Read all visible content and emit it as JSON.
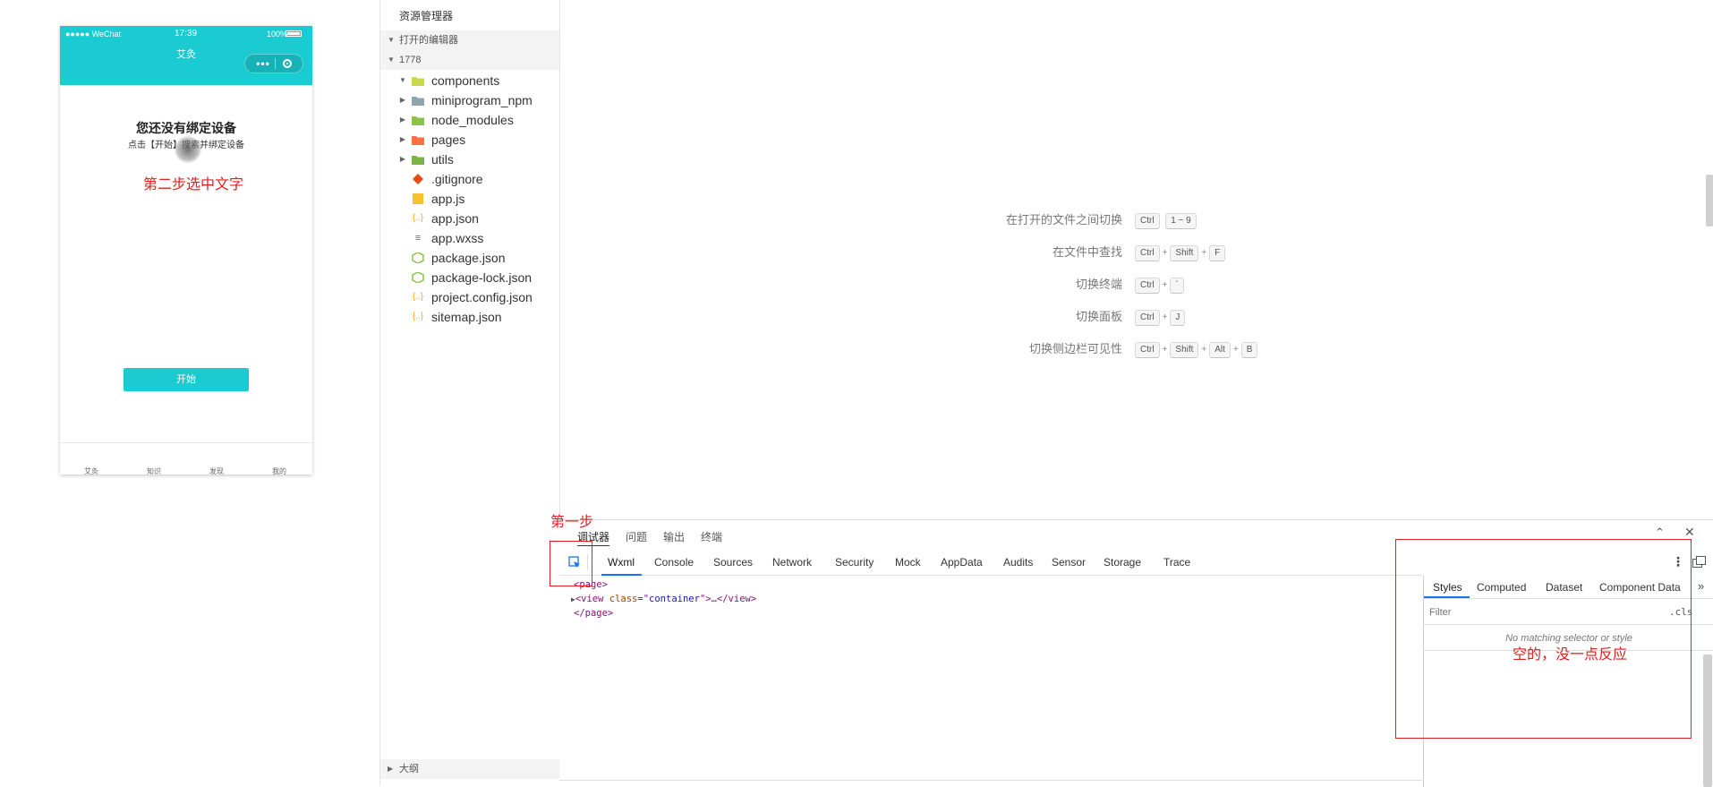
{
  "simulator": {
    "status_left": "●●●●● WeChat",
    "status_time": "17:39",
    "status_battery": "100%",
    "nav_title": "艾灸",
    "capsule_dots": "•••",
    "heading": "您还没有绑定设备",
    "subtext": "点击【开始】搜索并绑定设备",
    "start_button": "开始",
    "tabbar": [
      "艾灸",
      "知识",
      "发现",
      "我的"
    ]
  },
  "explorer": {
    "title": "资源管理器",
    "open_editors": "打开的编辑器",
    "project": "1778",
    "items": [
      {
        "label": "components",
        "type": "folder",
        "icon": "folder-components-icon"
      },
      {
        "label": "miniprogram_npm",
        "type": "folder",
        "icon": "folder-icon"
      },
      {
        "label": "node_modules",
        "type": "folder",
        "icon": "folder-node-icon"
      },
      {
        "label": "pages",
        "type": "folder",
        "icon": "folder-pages-icon"
      },
      {
        "label": "utils",
        "type": "folder",
        "icon": "folder-utils-icon"
      },
      {
        "label": ".gitignore",
        "type": "file",
        "icon": "git-icon"
      },
      {
        "label": "app.js",
        "type": "file",
        "icon": "js-icon"
      },
      {
        "label": "app.json",
        "type": "file",
        "icon": "json-icon"
      },
      {
        "label": "app.wxss",
        "type": "file",
        "icon": "css-icon"
      },
      {
        "label": "package.json",
        "type": "file",
        "icon": "npm-icon"
      },
      {
        "label": "package-lock.json",
        "type": "file",
        "icon": "npm-icon"
      },
      {
        "label": "project.config.json",
        "type": "file",
        "icon": "json-icon"
      },
      {
        "label": "sitemap.json",
        "type": "file",
        "icon": "json-icon"
      }
    ],
    "outline": "大纲"
  },
  "welcome": {
    "shortcuts": [
      {
        "label": "在打开的文件之间切换",
        "keys": [
          "Ctrl",
          "1 ~ 9"
        ],
        "joined": false
      },
      {
        "label": "在文件中查找",
        "keys": [
          "Ctrl",
          "Shift",
          "F"
        ],
        "joined": true
      },
      {
        "label": "切换终端",
        "keys": [
          "Ctrl",
          "`"
        ],
        "joined": true
      },
      {
        "label": "切换面板",
        "keys": [
          "Ctrl",
          "J"
        ],
        "joined": true
      },
      {
        "label": "切换侧边栏可见性",
        "keys": [
          "Ctrl",
          "Shift",
          "Alt",
          "B"
        ],
        "joined": true
      }
    ]
  },
  "panel": {
    "top_tabs": [
      "调试器",
      "问题",
      "输出",
      "终端"
    ],
    "active_top_tab": "调试器",
    "dev_tabs": [
      "Wxml",
      "Console",
      "Sources",
      "Network",
      "Security",
      "Mock",
      "AppData",
      "Audits",
      "Sensor",
      "Storage",
      "Trace"
    ],
    "active_dev_tab": "Wxml",
    "wxml": {
      "line1": "<page>",
      "line2_open": "<view ",
      "line2_attr": "class",
      "line2_eq": "=\"",
      "line2_val": "container",
      "line2_close": "\">…</view>",
      "line3": "</page>"
    },
    "styles": {
      "tabs": [
        "Styles",
        "Computed",
        "Dataset",
        "Component Data"
      ],
      "active_tab": "Styles",
      "filter_placeholder": "Filter",
      "cls_label": ".cls",
      "empty_message": "No matching selector or style"
    }
  },
  "annotations": {
    "step1": "第一步",
    "step2": "第二步选中文字",
    "note": "空的，没一点反应",
    "color": "#e02020"
  },
  "colors": {
    "accent": "#1bcbd2",
    "link": "#1a73e8"
  }
}
